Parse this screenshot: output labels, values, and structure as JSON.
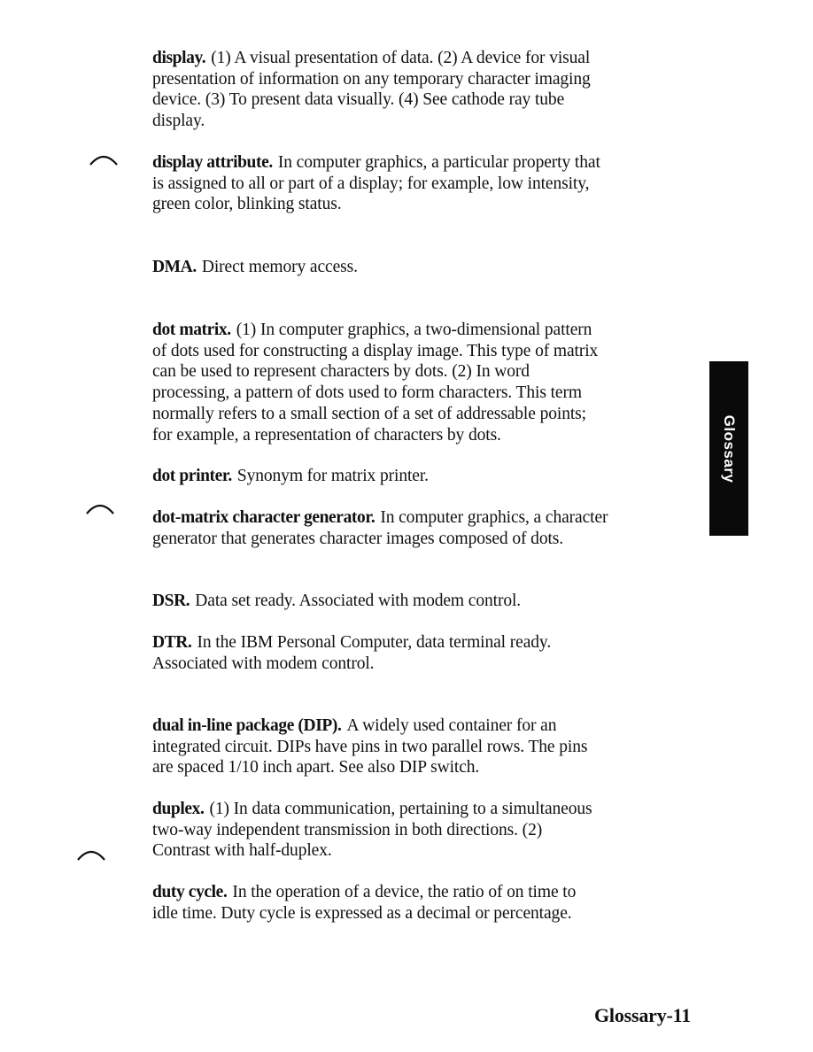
{
  "page": {
    "section_tab": "Glossary",
    "footer_label": "Glossary-11"
  },
  "entries": [
    {
      "term": "display.",
      "lines": [
        "(1) A visual presentation of data.  (2) A device for visual",
        "presentation of information on any temporary character imaging",
        "device.  (3) To present data visually.  (4) See cathode ray tube",
        "display."
      ]
    },
    {
      "term": "display attribute.",
      "lines": [
        "In computer graphics, a particular property that",
        "is assigned to all or part of a display; for example, low intensity,",
        "green color, blinking status."
      ]
    },
    {
      "term": "DMA.",
      "lines": [
        "Direct memory access."
      ]
    },
    {
      "term": "dot matrix.",
      "lines": [
        "(1) In computer graphics, a two-dimensional pattern",
        "of dots used for constructing a display image.  This type of matrix",
        "can be used to represent characters by dots.  (2) In word",
        "processing, a pattern of dots used to form characters.  This term",
        "normally refers to a small section of a set of addressable points;",
        "for example, a representation of characters by dots."
      ]
    },
    {
      "term": "dot printer.",
      "lines": [
        "Synonym for matrix printer."
      ]
    },
    {
      "term": "dot-matrix character generator.",
      "lines": [
        "In computer graphics, a character",
        "generator that generates character images composed of dots."
      ]
    },
    {
      "term": "DSR.",
      "lines": [
        "Data set ready. Associated with modem control."
      ]
    },
    {
      "term": "DTR.",
      "lines": [
        "In the IBM Personal Computer, data terminal ready.",
        "Associated with modem control."
      ]
    },
    {
      "term": "dual in-line package (DIP).",
      "lines": [
        "A widely used container for an",
        "integrated circuit. DIPs have pins in two parallel rows. The pins",
        "are spaced 1/10 inch apart. See also DIP switch."
      ]
    },
    {
      "term": "duplex.",
      "lines": [
        "(1) In data communication, pertaining to a simultaneous",
        "two-way independent transmission in both directions.  (2)",
        "Contrast with half-duplex."
      ]
    },
    {
      "term": "duty cycle.",
      "lines": [
        "In the operation of a device, the ratio of on time to",
        "idle time.  Duty cycle is expressed as a decimal or percentage."
      ]
    }
  ]
}
